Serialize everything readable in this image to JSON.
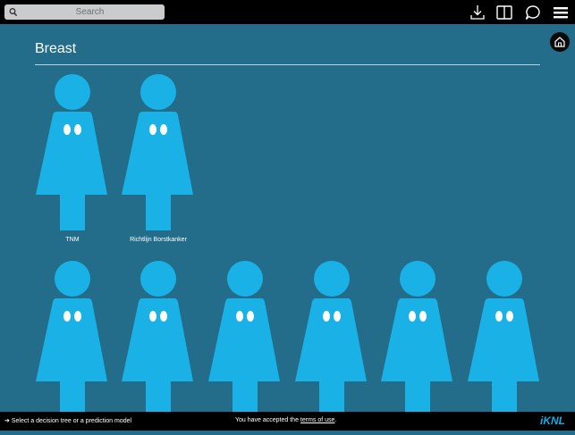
{
  "search": {
    "placeholder": "Search"
  },
  "toolbar": {
    "icons": [
      "download-icon",
      "book-icon",
      "chat-bubble-icon",
      "menu-icon"
    ]
  },
  "section": {
    "title": "Breast"
  },
  "tiles": [
    {
      "label": "TNM"
    },
    {
      "label": "Richtlijn Borstkanker"
    },
    {
      "label": ""
    },
    {
      "label": ""
    },
    {
      "label": ""
    },
    {
      "label": ""
    },
    {
      "label": ""
    },
    {
      "label": ""
    }
  ],
  "footer": {
    "left": "Select a decision tree or a prediction model",
    "accepted_prefix": "You have accepted the ",
    "terms_link": "terms of use",
    "accepted_suffix": ".",
    "logo": "iKNL"
  },
  "colors": {
    "background": "#236d8a",
    "figure": "#19b1e6",
    "bars": "#000000"
  }
}
